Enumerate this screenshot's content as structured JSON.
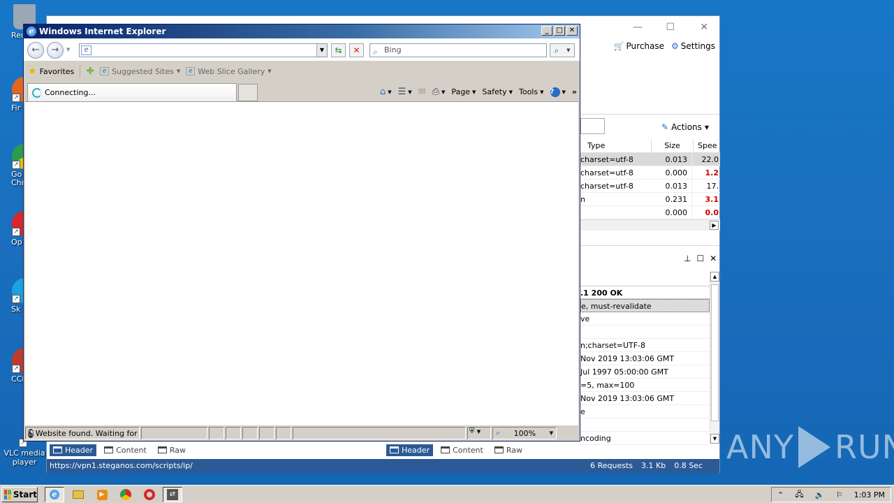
{
  "desktop": {
    "icons": [
      {
        "label": "Recy",
        "color": "#9aa7b5"
      },
      {
        "label": "Fir",
        "color": "#e3661d"
      },
      {
        "label": "Go Chr",
        "color": "#2c9c4a"
      },
      {
        "label": "Op",
        "color": "#d8262a"
      },
      {
        "label": "Sk",
        "color": "#1aa1e0"
      },
      {
        "label": "CCle",
        "color": "#c43a2a"
      },
      {
        "label": "VLC media player",
        "color": "#f28c00"
      }
    ],
    "watermark": {
      "left": "ANY",
      "right": "RUN"
    }
  },
  "bg_app": {
    "menu": {
      "purchase": "Purchase",
      "settings": "Settings"
    },
    "actions_label": "Actions",
    "columns": {
      "type": "Type",
      "size": "Size",
      "speed": "Spee"
    },
    "rows": [
      {
        "type": "charset=utf-8",
        "size": "0.013",
        "speed": "22.0",
        "red": false
      },
      {
        "type": "charset=utf-8",
        "size": "0.000",
        "speed": "1.2",
        "red": true
      },
      {
        "type": "charset=utf-8",
        "size": "0.013",
        "speed": "17.",
        "red": false
      },
      {
        "type": "n",
        "size": "0.231",
        "speed": "3.1",
        "red": true
      },
      {
        "type": "",
        "size": "0.000",
        "speed": "0.0",
        "red": true
      }
    ],
    "response_lines": [
      ".1 200 OK",
      "e, must-revalidate",
      "ve",
      "",
      "n;charset=UTF-8",
      "Nov 2019 13:03:06 GMT",
      "Jul 1997 05:00:00 GMT",
      "=5, max=100",
      "Nov 2019 13:03:06 GMT",
      "e",
      "",
      "ncoding"
    ],
    "left_tabs": {
      "header": "Header",
      "content": "Content",
      "raw": "Raw"
    },
    "right_tabs": {
      "header": "Header",
      "content": "Content",
      "raw": "Raw"
    },
    "status": {
      "url": "https://vpn1.steganos.com/scripts/ip/",
      "requests": "6 Requests",
      "size": "3.1 Kb",
      "time": "0.8 Sec"
    }
  },
  "ie": {
    "title": "Windows Internet Explorer",
    "address_value": "",
    "search_placeholder": "Bing",
    "favorites_label": "Favorites",
    "suggested_sites": "Suggested Sites",
    "web_slice_gallery": "Web Slice Gallery",
    "tab_label": "Connecting...",
    "commands": {
      "page": "Page",
      "safety": "Safety",
      "tools": "Tools"
    },
    "status_text": "Website found. Waiting for re",
    "zoom": "100%"
  },
  "taskbar": {
    "start_label": "Start",
    "clock": "1:03 PM"
  }
}
